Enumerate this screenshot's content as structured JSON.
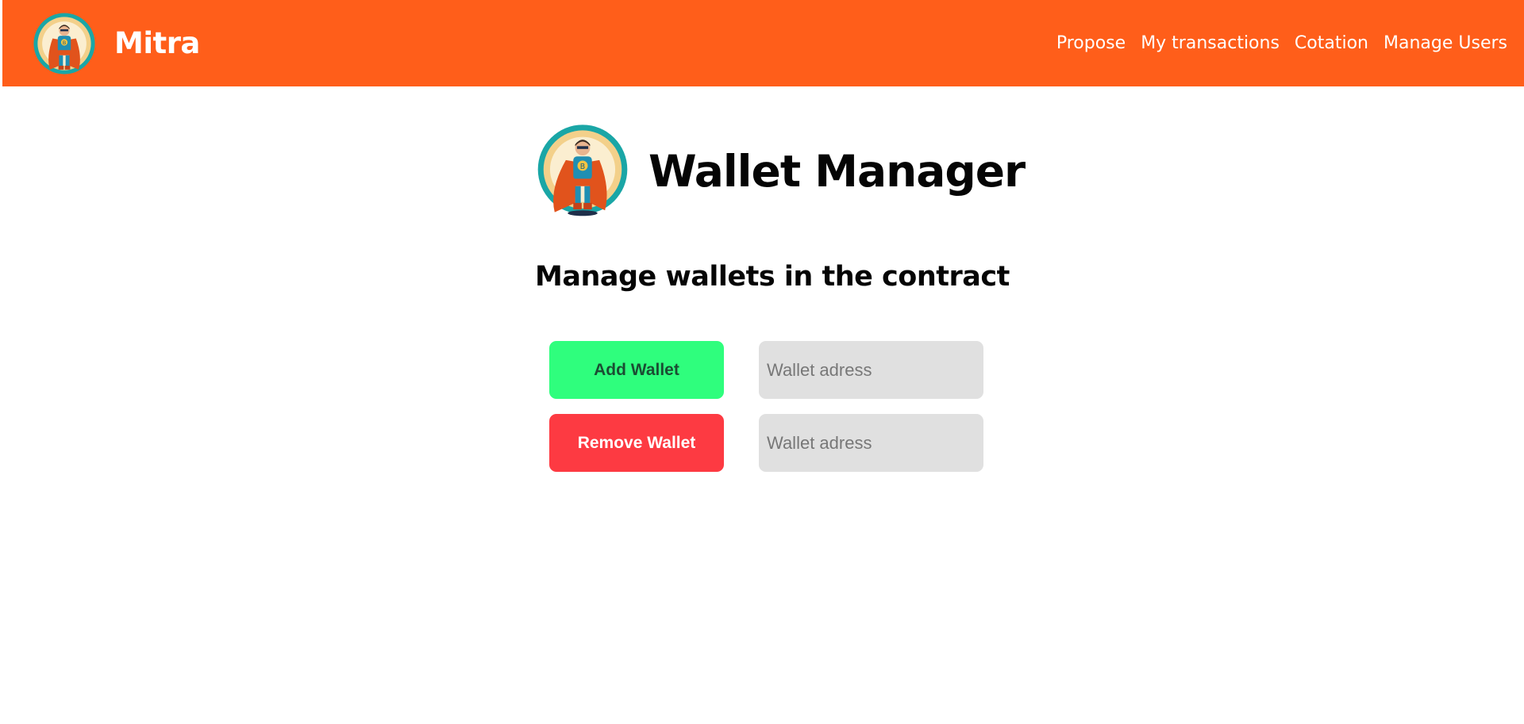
{
  "navbar": {
    "brand_name": "Mitra",
    "links": [
      {
        "label": "Propose"
      },
      {
        "label": "My transactions"
      },
      {
        "label": "Cotation"
      },
      {
        "label": "Manage Users"
      }
    ]
  },
  "hero": {
    "title": "Wallet Manager"
  },
  "main": {
    "subtitle": "Manage wallets in the contract",
    "add_wallet": {
      "button_label": "Add Wallet",
      "input_value": "",
      "input_placeholder": "Wallet adress"
    },
    "remove_wallet": {
      "button_label": "Remove Wallet",
      "input_value": "",
      "input_placeholder": "Wallet adress"
    }
  },
  "colors": {
    "navbar_bg": "#ff5e1a",
    "add_button_bg": "#2ffe7d",
    "remove_button_bg": "#fd3a42",
    "input_bg": "#e0e0e0"
  }
}
